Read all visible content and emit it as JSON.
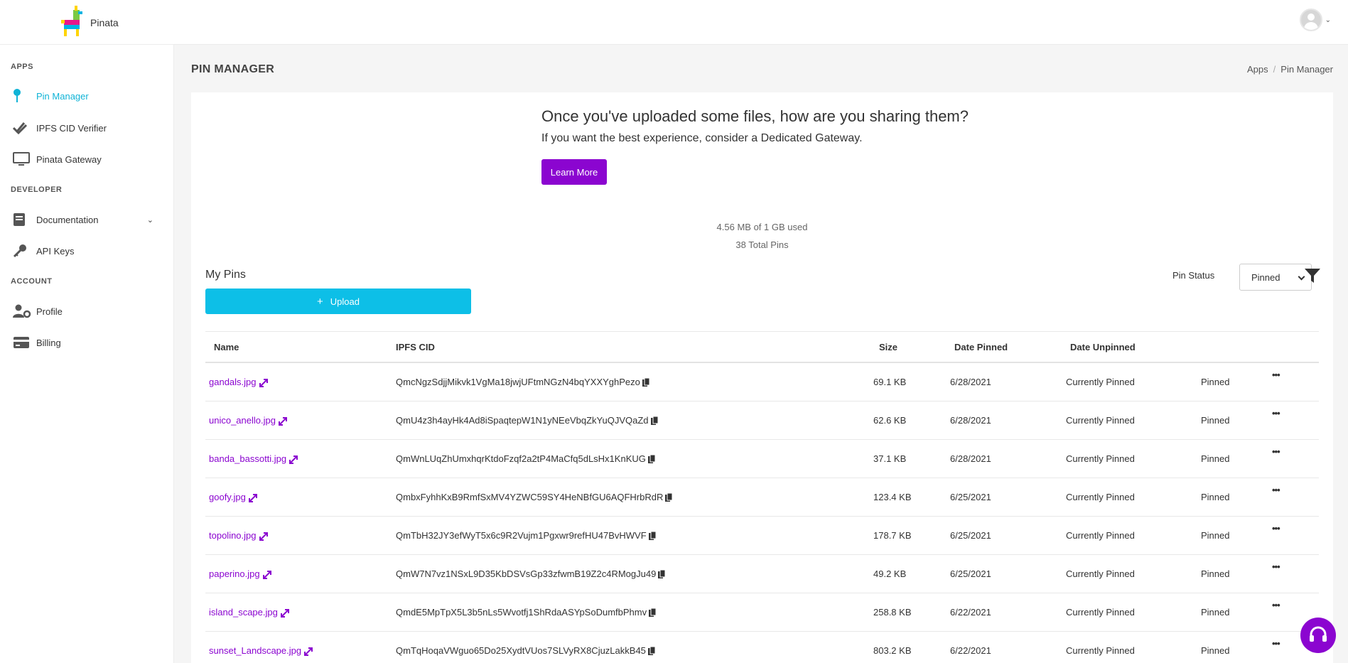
{
  "app": {
    "name": "Pinata"
  },
  "sidebar": {
    "sections": {
      "apps": "APPS",
      "developer": "DEVELOPER",
      "account": "ACCOUNT"
    },
    "items": [
      {
        "label": "Pin Manager",
        "icon": "pin-icon",
        "active": true
      },
      {
        "label": "IPFS CID Verifier",
        "icon": "double-check-icon"
      },
      {
        "label": "Pinata Gateway",
        "icon": "monitor-icon"
      },
      {
        "label": "Documentation",
        "icon": "book-icon"
      },
      {
        "label": "API Keys",
        "icon": "key-icon"
      },
      {
        "label": "Profile",
        "icon": "user-cog-icon"
      },
      {
        "label": "Billing",
        "icon": "credit-card-icon"
      }
    ]
  },
  "header": {
    "title": "PIN MANAGER",
    "breadcrumb": [
      "Apps",
      "Pin Manager"
    ]
  },
  "promo": {
    "title": "Once you've uploaded some files, how are you sharing them?",
    "subtitle": "If you want the best experience, consider a Dedicated Gateway.",
    "button": "Learn More"
  },
  "usage": {
    "used": "4.56 MB of 1 GB used",
    "total": "38 Total Pins"
  },
  "pins": {
    "heading": "My Pins",
    "upload_label": "Upload",
    "status_label": "Pin Status",
    "status_value": "Pinned",
    "columns": [
      "Name",
      "IPFS CID",
      "Size",
      "Date Pinned",
      "Date Unpinned"
    ],
    "rows": [
      {
        "name": "gandals.jpg",
        "cid": "QmcNgzSdjjMikvk1VgMa18jwjUFtmNGzN4bqYXXYghPezo",
        "size": "69.1 KB",
        "date_pinned": "6/28/2021",
        "date_unpinned": "Currently Pinned",
        "status": "Pinned"
      },
      {
        "name": "unico_anello.jpg",
        "cid": "QmU4z3h4ayHk4Ad8iSpaqtepW1N1yNEeVbqZkYuQJVQaZd",
        "size": "62.6 KB",
        "date_pinned": "6/28/2021",
        "date_unpinned": "Currently Pinned",
        "status": "Pinned"
      },
      {
        "name": "banda_bassotti.jpg",
        "cid": "QmWnLUqZhUmxhqrKtdoFzqf2a2tP4MaCfq5dLsHx1KnKUG",
        "size": "37.1 KB",
        "date_pinned": "6/28/2021",
        "date_unpinned": "Currently Pinned",
        "status": "Pinned"
      },
      {
        "name": "goofy.jpg",
        "cid": "QmbxFyhhKxB9RmfSxMV4YZWC59SY4HeNBfGU6AQFHrbRdR",
        "size": "123.4 KB",
        "date_pinned": "6/25/2021",
        "date_unpinned": "Currently Pinned",
        "status": "Pinned"
      },
      {
        "name": "topolino.jpg",
        "cid": "QmTbH32JY3efWyT5x6c9R2Vujm1Pgxwr9refHU47BvHWVF",
        "size": "178.7 KB",
        "date_pinned": "6/25/2021",
        "date_unpinned": "Currently Pinned",
        "status": "Pinned"
      },
      {
        "name": "paperino.jpg",
        "cid": "QmW7N7vz1NSxL9D35KbDSVsGp33zfwmB19Z2c4RMogJu49",
        "size": "49.2 KB",
        "date_pinned": "6/25/2021",
        "date_unpinned": "Currently Pinned",
        "status": "Pinned"
      },
      {
        "name": "island_scape.jpg",
        "cid": "QmdE5MpTpX5L3b5nLs5Wvotfj1ShRdaASYpSoDumfbPhmv",
        "size": "258.8 KB",
        "date_pinned": "6/22/2021",
        "date_unpinned": "Currently Pinned",
        "status": "Pinned"
      },
      {
        "name": "sunset_Landscape.jpg",
        "cid": "QmTqHoqaVWguo65Do25XydtVUos7SLVyRX8CjuzLakkB45",
        "size": "803.2 KB",
        "date_pinned": "6/22/2021",
        "date_unpinned": "Currently Pinned",
        "status": "Pinned"
      }
    ]
  },
  "colors": {
    "accent_purple": "#8b05d0",
    "accent_cyan": "#0dbfe7",
    "active_nav": "#0fb3d6"
  }
}
